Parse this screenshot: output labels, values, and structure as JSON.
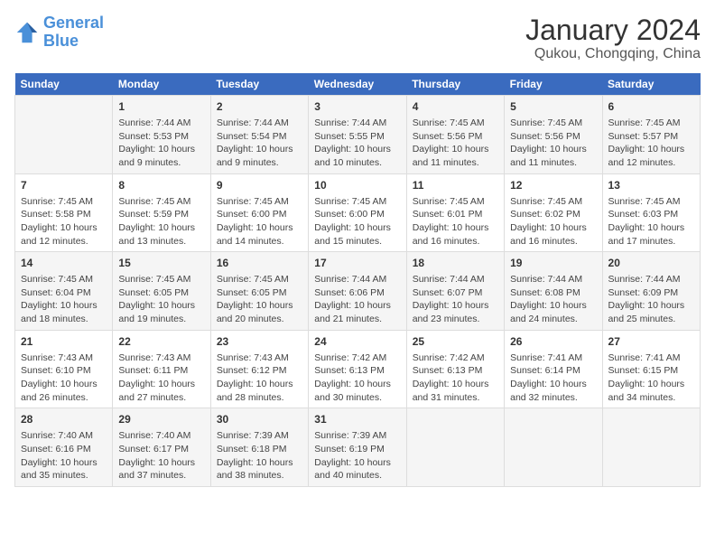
{
  "logo": {
    "line1": "General",
    "line2": "Blue"
  },
  "title": "January 2024",
  "subtitle": "Qukou, Chongqing, China",
  "days_of_week": [
    "Sunday",
    "Monday",
    "Tuesday",
    "Wednesday",
    "Thursday",
    "Friday",
    "Saturday"
  ],
  "weeks": [
    [
      {
        "num": "",
        "info": ""
      },
      {
        "num": "1",
        "info": "Sunrise: 7:44 AM\nSunset: 5:53 PM\nDaylight: 10 hours\nand 9 minutes."
      },
      {
        "num": "2",
        "info": "Sunrise: 7:44 AM\nSunset: 5:54 PM\nDaylight: 10 hours\nand 9 minutes."
      },
      {
        "num": "3",
        "info": "Sunrise: 7:44 AM\nSunset: 5:55 PM\nDaylight: 10 hours\nand 10 minutes."
      },
      {
        "num": "4",
        "info": "Sunrise: 7:45 AM\nSunset: 5:56 PM\nDaylight: 10 hours\nand 11 minutes."
      },
      {
        "num": "5",
        "info": "Sunrise: 7:45 AM\nSunset: 5:56 PM\nDaylight: 10 hours\nand 11 minutes."
      },
      {
        "num": "6",
        "info": "Sunrise: 7:45 AM\nSunset: 5:57 PM\nDaylight: 10 hours\nand 12 minutes."
      }
    ],
    [
      {
        "num": "7",
        "info": "Sunrise: 7:45 AM\nSunset: 5:58 PM\nDaylight: 10 hours\nand 12 minutes."
      },
      {
        "num": "8",
        "info": "Sunrise: 7:45 AM\nSunset: 5:59 PM\nDaylight: 10 hours\nand 13 minutes."
      },
      {
        "num": "9",
        "info": "Sunrise: 7:45 AM\nSunset: 6:00 PM\nDaylight: 10 hours\nand 14 minutes."
      },
      {
        "num": "10",
        "info": "Sunrise: 7:45 AM\nSunset: 6:00 PM\nDaylight: 10 hours\nand 15 minutes."
      },
      {
        "num": "11",
        "info": "Sunrise: 7:45 AM\nSunset: 6:01 PM\nDaylight: 10 hours\nand 16 minutes."
      },
      {
        "num": "12",
        "info": "Sunrise: 7:45 AM\nSunset: 6:02 PM\nDaylight: 10 hours\nand 16 minutes."
      },
      {
        "num": "13",
        "info": "Sunrise: 7:45 AM\nSunset: 6:03 PM\nDaylight: 10 hours\nand 17 minutes."
      }
    ],
    [
      {
        "num": "14",
        "info": "Sunrise: 7:45 AM\nSunset: 6:04 PM\nDaylight: 10 hours\nand 18 minutes."
      },
      {
        "num": "15",
        "info": "Sunrise: 7:45 AM\nSunset: 6:05 PM\nDaylight: 10 hours\nand 19 minutes."
      },
      {
        "num": "16",
        "info": "Sunrise: 7:45 AM\nSunset: 6:05 PM\nDaylight: 10 hours\nand 20 minutes."
      },
      {
        "num": "17",
        "info": "Sunrise: 7:44 AM\nSunset: 6:06 PM\nDaylight: 10 hours\nand 21 minutes."
      },
      {
        "num": "18",
        "info": "Sunrise: 7:44 AM\nSunset: 6:07 PM\nDaylight: 10 hours\nand 23 minutes."
      },
      {
        "num": "19",
        "info": "Sunrise: 7:44 AM\nSunset: 6:08 PM\nDaylight: 10 hours\nand 24 minutes."
      },
      {
        "num": "20",
        "info": "Sunrise: 7:44 AM\nSunset: 6:09 PM\nDaylight: 10 hours\nand 25 minutes."
      }
    ],
    [
      {
        "num": "21",
        "info": "Sunrise: 7:43 AM\nSunset: 6:10 PM\nDaylight: 10 hours\nand 26 minutes."
      },
      {
        "num": "22",
        "info": "Sunrise: 7:43 AM\nSunset: 6:11 PM\nDaylight: 10 hours\nand 27 minutes."
      },
      {
        "num": "23",
        "info": "Sunrise: 7:43 AM\nSunset: 6:12 PM\nDaylight: 10 hours\nand 28 minutes."
      },
      {
        "num": "24",
        "info": "Sunrise: 7:42 AM\nSunset: 6:13 PM\nDaylight: 10 hours\nand 30 minutes."
      },
      {
        "num": "25",
        "info": "Sunrise: 7:42 AM\nSunset: 6:13 PM\nDaylight: 10 hours\nand 31 minutes."
      },
      {
        "num": "26",
        "info": "Sunrise: 7:41 AM\nSunset: 6:14 PM\nDaylight: 10 hours\nand 32 minutes."
      },
      {
        "num": "27",
        "info": "Sunrise: 7:41 AM\nSunset: 6:15 PM\nDaylight: 10 hours\nand 34 minutes."
      }
    ],
    [
      {
        "num": "28",
        "info": "Sunrise: 7:40 AM\nSunset: 6:16 PM\nDaylight: 10 hours\nand 35 minutes."
      },
      {
        "num": "29",
        "info": "Sunrise: 7:40 AM\nSunset: 6:17 PM\nDaylight: 10 hours\nand 37 minutes."
      },
      {
        "num": "30",
        "info": "Sunrise: 7:39 AM\nSunset: 6:18 PM\nDaylight: 10 hours\nand 38 minutes."
      },
      {
        "num": "31",
        "info": "Sunrise: 7:39 AM\nSunset: 6:19 PM\nDaylight: 10 hours\nand 40 minutes."
      },
      {
        "num": "",
        "info": ""
      },
      {
        "num": "",
        "info": ""
      },
      {
        "num": "",
        "info": ""
      }
    ]
  ]
}
